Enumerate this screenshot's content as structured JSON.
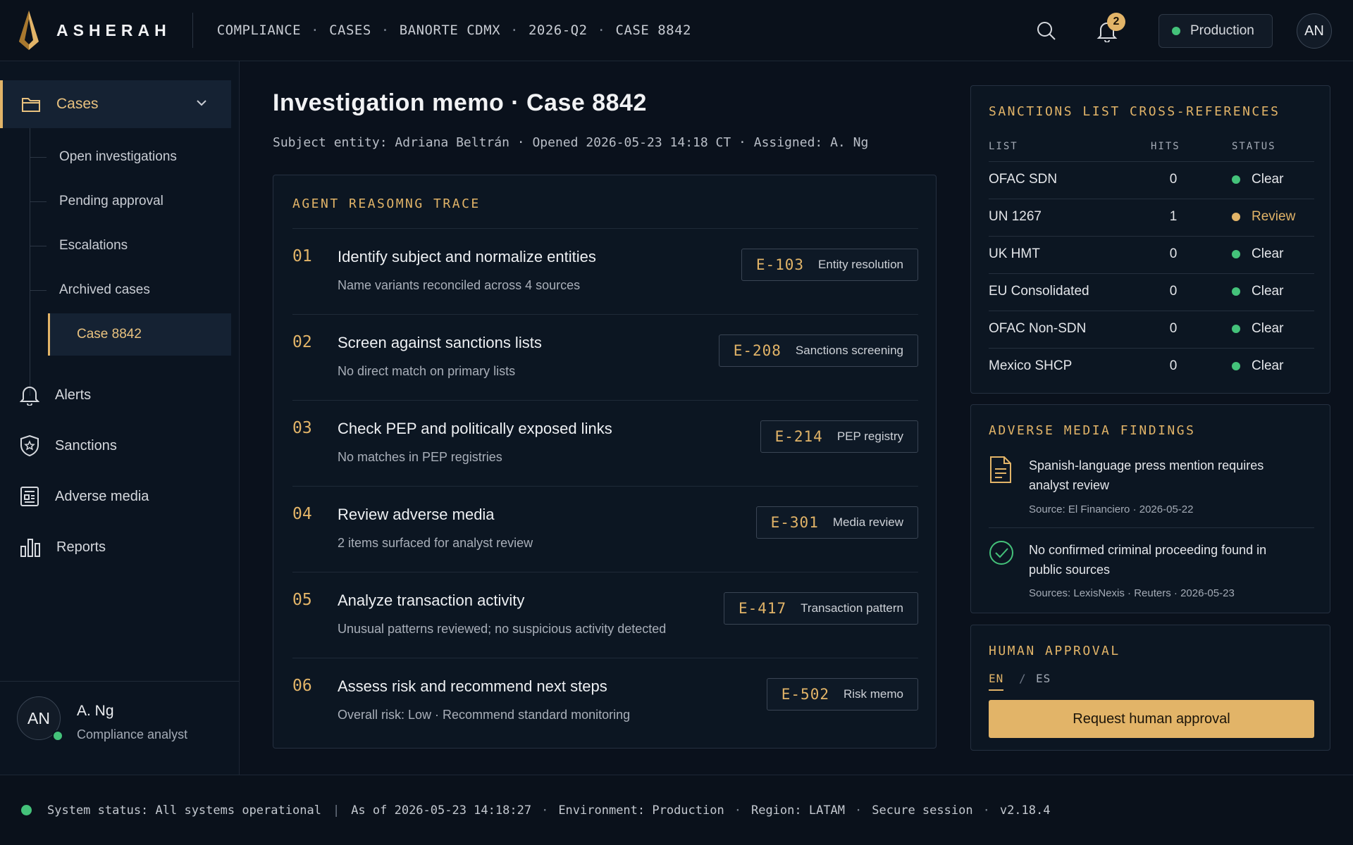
{
  "app": {
    "name": "ASHERAH"
  },
  "breadcrumb": [
    "COMPLIANCE",
    "CASES",
    "BANORTE CDMX",
    "2026-Q2",
    "CASE 8842"
  ],
  "topbar": {
    "notification_count": "2",
    "environment": "Production",
    "user_initials": "AN"
  },
  "sidebar": {
    "cases": {
      "label": "Cases",
      "subitems": [
        "Open investigations",
        "Pending approval",
        "Escalations",
        "Archived cases"
      ],
      "active_item": "Case 8842"
    },
    "items": [
      {
        "label": "Alerts",
        "icon": "bell-icon"
      },
      {
        "label": "Sanctions",
        "icon": "shield-icon"
      },
      {
        "label": "Adverse media",
        "icon": "newspaper-icon"
      },
      {
        "label": "Reports",
        "icon": "bar-chart-icon"
      }
    ],
    "user": {
      "initials": "AN",
      "name": "A. Ng",
      "role": "Compliance analyst"
    }
  },
  "main": {
    "title": "Investigation memo · Case 8842",
    "meta": "Subject entity: Adriana Beltrán · Opened 2026-05-23 14:18 CT · Assigned: A. Ng",
    "trace": {
      "heading": "AGENT REASOMNG TRACE",
      "steps": [
        {
          "num": "01",
          "title": "Identify subject and normalize entities",
          "sub": "Name variants reconciled across 4 sources",
          "code": "E-103",
          "evidence": "Entity resolution"
        },
        {
          "num": "02",
          "title": "Screen against sanctions lists",
          "sub": "No direct match on primary lists",
          "code": "E-208",
          "evidence": "Sanctions screening"
        },
        {
          "num": "03",
          "title": "Check PEP and politically exposed links",
          "sub": "No matches in PEP registries",
          "code": "E-214",
          "evidence": "PEP registry"
        },
        {
          "num": "04",
          "title": "Review adverse media",
          "sub": "2 items surfaced for analyst review",
          "code": "E-301",
          "evidence": "Media review"
        },
        {
          "num": "05",
          "title": "Analyze transaction activity",
          "sub": "Unusual patterns reviewed; no suspicious activity detected",
          "code": "E-417",
          "evidence": "Transaction pattern"
        },
        {
          "num": "06",
          "title": "Assess risk and recommend next steps",
          "sub": "Overall risk: Low · Recommend standard monitoring",
          "code": "E-502",
          "evidence": "Risk memo"
        }
      ]
    }
  },
  "sanctions": {
    "heading": "SANCTIONS LIST CROSS-REFERENCES",
    "columns": [
      "LIST",
      "HITS",
      "STATUS"
    ],
    "rows": [
      {
        "list": "OFAC SDN",
        "hits": "0",
        "status": "Clear",
        "color": "#44c27a"
      },
      {
        "list": "UN 1267",
        "hits": "1",
        "status": "Review",
        "color": "#e2b468"
      },
      {
        "list": "UK HMT",
        "hits": "0",
        "status": "Clear",
        "color": "#44c27a"
      },
      {
        "list": "EU Consolidated",
        "hits": "0",
        "status": "Clear",
        "color": "#44c27a"
      },
      {
        "list": "OFAC Non-SDN",
        "hits": "0",
        "status": "Clear",
        "color": "#44c27a"
      },
      {
        "list": "Mexico SHCP",
        "hits": "0",
        "status": "Clear",
        "color": "#44c27a"
      }
    ]
  },
  "adverse": {
    "heading": "ADVERSE MEDIA FINDINGS",
    "findings": [
      {
        "icon": "document-icon",
        "text": "Spanish-language press mention requires analyst review",
        "source": "Source: El Financiero · 2026-05-22"
      },
      {
        "icon": "check-circle-icon",
        "text": "No confirmed criminal proceeding found in public sources",
        "source": "Sources: LexisNexis · Reuters · 2026-05-23"
      }
    ]
  },
  "approval": {
    "heading": "HUMAN APPROVAL",
    "lang_en": "EN",
    "lang_sep": "/",
    "lang_es": "ES",
    "button": "Request human approval"
  },
  "status": {
    "system": "System status: All systems operational",
    "as_of": "As of 2026-05-23 14:18:27",
    "environment": "Environment: Production",
    "region": "Region: LATAM",
    "session": "Secure session",
    "version": "v2.18.4"
  },
  "colors": {
    "accent": "#e2b468",
    "ok": "#44c27a",
    "background": "#0a111c"
  }
}
